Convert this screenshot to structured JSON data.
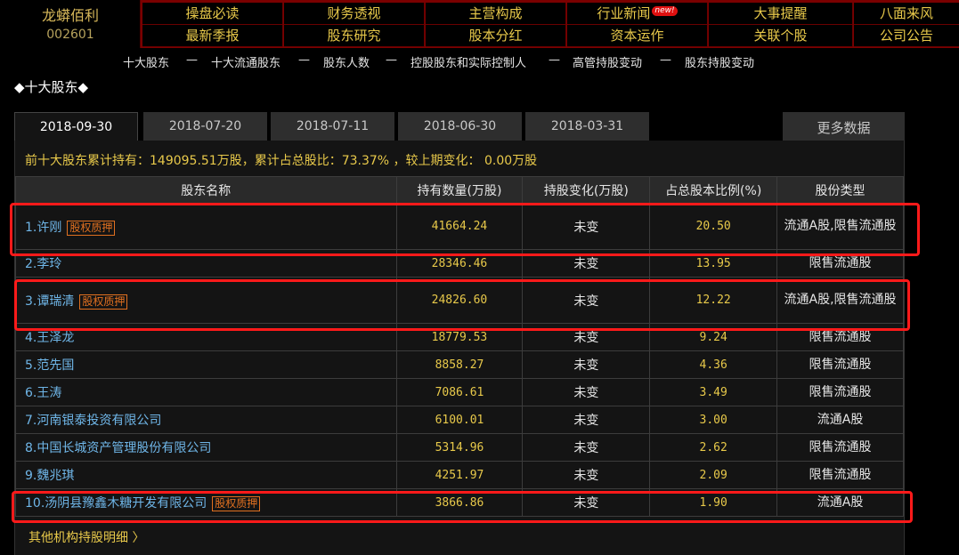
{
  "stock": {
    "name": "龙蟒佰利",
    "code": "002601"
  },
  "nav": {
    "row1": [
      "操盘必读",
      "财务透视",
      "主营构成",
      "行业新闻",
      "大事提醒",
      "八面来风"
    ],
    "row2": [
      "最新季报",
      "股东研究",
      "股本分红",
      "资本运作",
      "关联个股",
      "公司公告"
    ],
    "new_badge": "new!"
  },
  "subnav": [
    "十大股东",
    "—",
    "十大流通股东",
    "—",
    "股东人数",
    "—",
    "控股股东和实际控制人",
    "—",
    "高管持股变动",
    "—",
    "股东持股变动"
  ],
  "section_title": "◆十大股东◆",
  "tabs": [
    "2018-09-30",
    "2018-07-20",
    "2018-07-11",
    "2018-06-30",
    "2018-03-31"
  ],
  "more_data": "更多数据",
  "summary": "前十大股东累计持有：149095.51万股，累计占总股比：73.37% ，较上期变化：  0.00万股",
  "table": {
    "headers": [
      "股东名称",
      "持有数量(万股)",
      "持股变化(万股)",
      "占总股本比例(%)",
      "股份类型"
    ],
    "rows": [
      {
        "name": "1.许刚",
        "pledge": "股权质押",
        "qty": "41664.24",
        "change": "未变",
        "pct": "20.50",
        "type": "流通A股,限售流通股"
      },
      {
        "name": "2.李玲",
        "pledge": "",
        "qty": "28346.46",
        "change": "未变",
        "pct": "13.95",
        "type": "限售流通股"
      },
      {
        "name": "3.谭瑞清",
        "pledge": "股权质押",
        "qty": "24826.60",
        "change": "未变",
        "pct": "12.22",
        "type": "流通A股,限售流通股"
      },
      {
        "name": "4.王泽龙",
        "pledge": "",
        "qty": "18779.53",
        "change": "未变",
        "pct": "9.24",
        "type": "限售流通股"
      },
      {
        "name": "5.范先国",
        "pledge": "",
        "qty": "8858.27",
        "change": "未变",
        "pct": "4.36",
        "type": "限售流通股"
      },
      {
        "name": "6.王涛",
        "pledge": "",
        "qty": "7086.61",
        "change": "未变",
        "pct": "3.49",
        "type": "限售流通股"
      },
      {
        "name": "7.河南银泰投资有限公司",
        "pledge": "",
        "qty": "6100.01",
        "change": "未变",
        "pct": "3.00",
        "type": "流通A股"
      },
      {
        "name": "8.中国长城资产管理股份有限公司",
        "pledge": "",
        "qty": "5314.96",
        "change": "未变",
        "pct": "2.62",
        "type": "限售流通股"
      },
      {
        "name": "9.魏兆琪",
        "pledge": "",
        "qty": "4251.97",
        "change": "未变",
        "pct": "2.09",
        "type": "限售流通股"
      },
      {
        "name": "10.汤阴县豫鑫木糖开发有限公司",
        "pledge": "股权质押",
        "qty": "3866.86",
        "change": "未变",
        "pct": "1.90",
        "type": "流通A股"
      }
    ]
  },
  "footer_link": "其他机构持股明细 〉",
  "colors": {
    "highlight": "#ff1a1a",
    "accent": "#e8c94a",
    "link": "#6fb6e8"
  }
}
